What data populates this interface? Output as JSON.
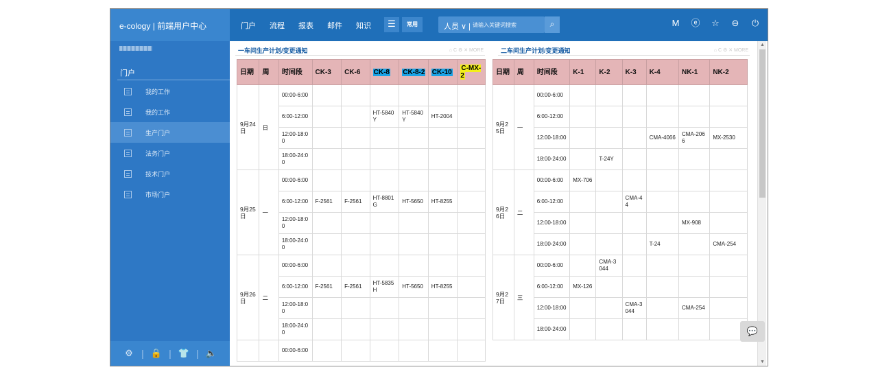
{
  "header": {
    "brand": "e-cology | 前端用户中心",
    "nav": [
      "门户",
      "流程",
      "报表",
      "邮件",
      "知识"
    ],
    "menu_icon": "☰",
    "common_label": "常用",
    "search_type": "人员 ∨ |",
    "search_placeholder": "请输入关键词搜索",
    "icons": [
      "M",
      "ⓔ",
      "☆",
      "⊖",
      "⏻"
    ]
  },
  "sidebar": {
    "title": "门户",
    "items": [
      {
        "label": "我的工作",
        "active": false
      },
      {
        "label": "我的工作",
        "active": false
      },
      {
        "label": "生产门户",
        "active": true
      },
      {
        "label": "法务门户",
        "active": false
      },
      {
        "label": "技术门户",
        "active": false
      },
      {
        "label": "市场门户",
        "active": false
      }
    ],
    "footer_icons": [
      "⚙",
      "🔒",
      "👕",
      "🔈"
    ]
  },
  "panel1": {
    "title": "一车间生产计划/变更通知",
    "tools": "⌂ C ⚙ ✕ MORE",
    "headers": [
      "日期",
      "周",
      "时间段",
      "CK-3",
      "CK-6",
      "CK-8",
      "CK-8-2",
      "CK-10",
      "C-MX-2"
    ],
    "groups": [
      {
        "date": "9月24日",
        "week": "日",
        "rows": [
          [
            "00:00-6:00",
            "",
            "",
            "",
            "",
            "",
            ""
          ],
          [
            "6:00-12:00",
            "",
            "",
            "HT-5840Y",
            "HT-5840Y",
            "HT-2004",
            ""
          ],
          [
            "12:00-18:00",
            "",
            "",
            "",
            "",
            "",
            ""
          ],
          [
            "18:00-24:00",
            "",
            "",
            "",
            "",
            "",
            ""
          ]
        ]
      },
      {
        "date": "9月25日",
        "week": "一",
        "rows": [
          [
            "00:00-6:00",
            "",
            "",
            "",
            "",
            "",
            ""
          ],
          [
            "6:00-12:00",
            "F-2561",
            "F-2561",
            "HT-8801G",
            "HT-5650",
            "HT-8255",
            ""
          ],
          [
            "12:00-18:00",
            "",
            "",
            "",
            "",
            "",
            ""
          ],
          [
            "18:00-24:00",
            "",
            "",
            "",
            "",
            "",
            ""
          ]
        ]
      },
      {
        "date": "9月26日",
        "week": "二",
        "rows": [
          [
            "00:00-6:00",
            "",
            "",
            "",
            "",
            "",
            ""
          ],
          [
            "6:00-12:00",
            "F-2561",
            "F-2561",
            "HT-5835H",
            "HT-5650",
            "HT-8255",
            ""
          ],
          [
            "12:00-18:00",
            "",
            "",
            "",
            "",
            "",
            ""
          ],
          [
            "18:00-24:00",
            "",
            "",
            "",
            "",
            "",
            ""
          ]
        ]
      },
      {
        "date": "",
        "week": "",
        "rows": [
          [
            "00:00-6:00",
            "",
            "",
            "",
            "",
            "",
            ""
          ]
        ]
      }
    ]
  },
  "panel2": {
    "title": "二车间生产计划/变更通知",
    "tools": "⌂ C ⚙ ✕ MORE",
    "headers": [
      "日期",
      "周",
      "时间段",
      "K-1",
      "K-2",
      "K-3",
      "K-4",
      "NK-1",
      "NK-2"
    ],
    "groups": [
      {
        "date": "9月25日",
        "week": "一",
        "rows": [
          [
            "00:00-6:00",
            "",
            "",
            "",
            "",
            "",
            ""
          ],
          [
            "6:00-12:00",
            "",
            "",
            "",
            "",
            "",
            ""
          ],
          [
            "12:00-18:00",
            "",
            "",
            "",
            "CMA-4066",
            "CMA-2066",
            "MX-2530"
          ],
          [
            "18:00-24:00",
            "",
            "T-24Y",
            "",
            "",
            "",
            ""
          ]
        ]
      },
      {
        "date": "9月26日",
        "week": "二",
        "rows": [
          [
            "00:00-6:00",
            "MX-706",
            "",
            "",
            "",
            "",
            ""
          ],
          [
            "6:00-12:00",
            "",
            "",
            "CMA-44",
            "",
            "",
            ""
          ],
          [
            "12:00-18:00",
            "",
            "",
            "",
            "",
            "MX-908",
            ""
          ],
          [
            "18:00-24:00",
            "",
            "",
            "",
            "T-24",
            "",
            "CMA-254"
          ]
        ]
      },
      {
        "date": "9月27日",
        "week": "三",
        "rows": [
          [
            "00:00-6:00",
            "",
            "CMA-3044",
            "",
            "",
            "",
            ""
          ],
          [
            "6:00-12:00",
            "MX-126",
            "",
            "",
            "",
            "",
            ""
          ],
          [
            "12:00-18:00",
            "",
            "",
            "CMA-3044",
            "",
            "CMA-254",
            ""
          ],
          [
            "18:00-24:00",
            "",
            "",
            "",
            "",
            "",
            ""
          ]
        ]
      }
    ]
  },
  "chat_icon": "💬"
}
